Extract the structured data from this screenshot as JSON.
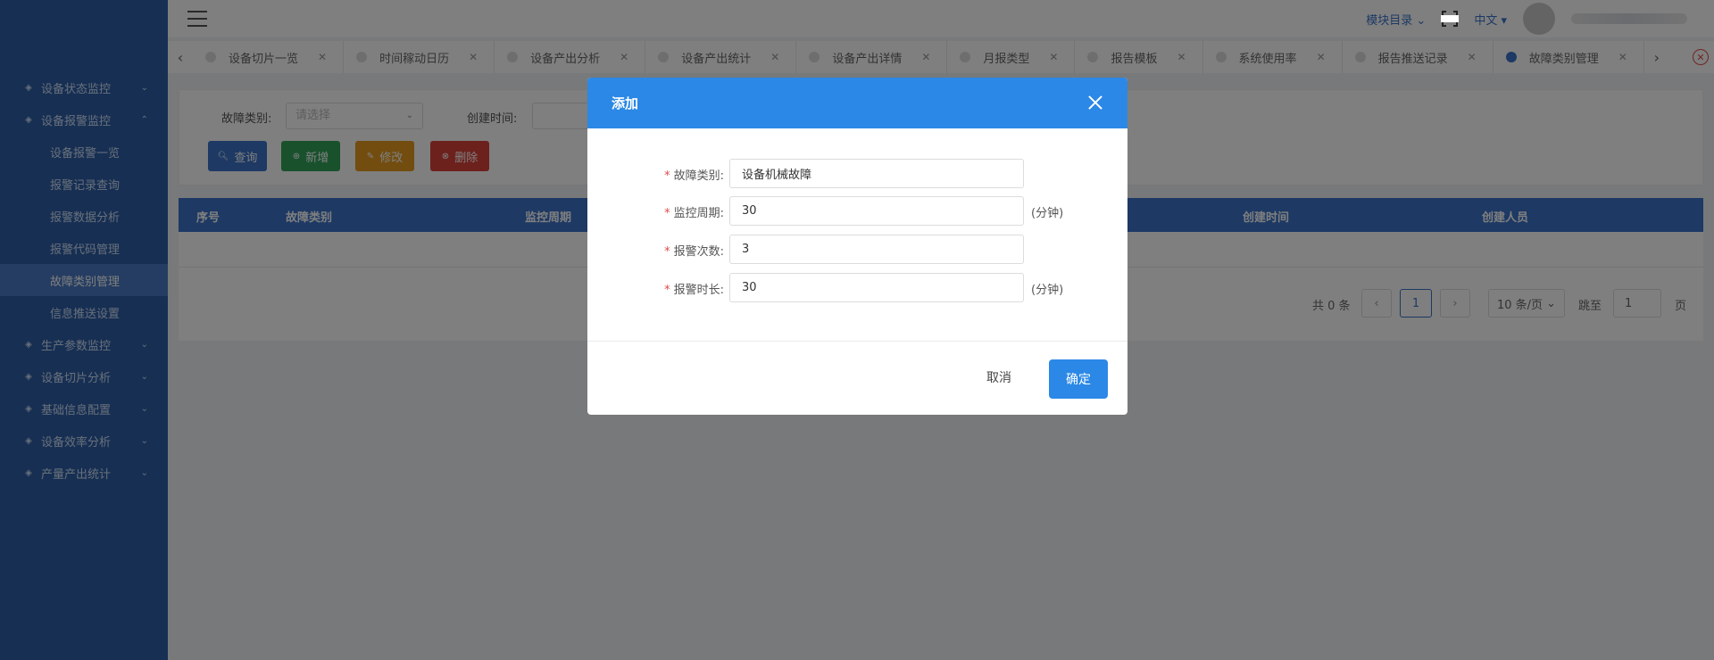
{
  "sidebar": {
    "items": [
      {
        "label": "设备状态监控",
        "expanded": false
      },
      {
        "label": "设备报警监控",
        "expanded": true,
        "children": [
          "设备报警一览",
          "报警记录查询",
          "报警数据分析",
          "报警代码管理",
          "故障类别管理",
          "信息推送设置"
        ],
        "active_child": "故障类别管理"
      },
      {
        "label": "生产参数监控",
        "expanded": false
      },
      {
        "label": "设备切片分析",
        "expanded": false
      },
      {
        "label": "基础信息配置",
        "expanded": false
      },
      {
        "label": "设备效率分析",
        "expanded": false
      },
      {
        "label": "产量产出统计",
        "expanded": false
      }
    ]
  },
  "header": {
    "module_menu": "模块目录",
    "language": "中文"
  },
  "tabs": [
    {
      "label": "设备切片一览",
      "active": false
    },
    {
      "label": "时间稼动日历",
      "active": false
    },
    {
      "label": "设备产出分析",
      "active": false
    },
    {
      "label": "设备产出统计",
      "active": false
    },
    {
      "label": "设备产出详情",
      "active": false
    },
    {
      "label": "月报类型",
      "active": false
    },
    {
      "label": "报告模板",
      "active": false
    },
    {
      "label": "系统使用率",
      "active": false
    },
    {
      "label": "报告推送记录",
      "active": false
    },
    {
      "label": "故障类别管理",
      "active": true
    }
  ],
  "search": {
    "fault_type_label": "故障类别:",
    "fault_type_placeholder": "请选择",
    "create_time_label": "创建时间:"
  },
  "toolbar": {
    "query": "查询",
    "add": "新增",
    "edit": "修改",
    "delete": "删除"
  },
  "table": {
    "columns": [
      "序号",
      "故障类别",
      "监控周期",
      "创建时间",
      "创建人员"
    ]
  },
  "pager": {
    "total": "共 0 条",
    "current_page": "1",
    "page_size": "10 条/页",
    "goto_label": "跳至",
    "goto_value": "1",
    "page_suffix": "页"
  },
  "modal": {
    "title": "添加",
    "fields": [
      {
        "label": "故障类别:",
        "value": "设备机械故障",
        "unit": ""
      },
      {
        "label": "监控周期:",
        "value": "30",
        "unit": "(分钟)"
      },
      {
        "label": "报警次数:",
        "value": "3",
        "unit": ""
      },
      {
        "label": "报警时长:",
        "value": "30",
        "unit": "(分钟)"
      }
    ],
    "required_mark": "*",
    "cancel": "取消",
    "confirm": "确定"
  },
  "colors": {
    "sidebar_bg": "#2f5fa6",
    "primary": "#2b88e6",
    "btn_query": "#3a73c8",
    "btn_add": "#33a35a",
    "btn_edit": "#e49b1f",
    "btn_delete": "#d9433a"
  }
}
